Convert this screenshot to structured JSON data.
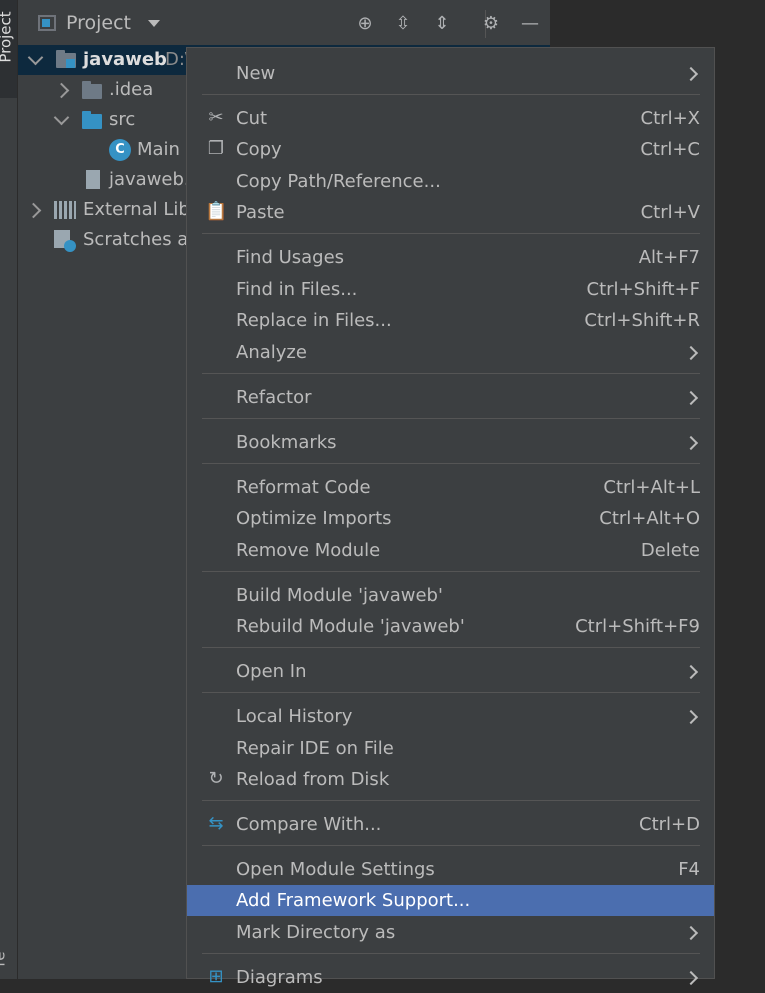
{
  "stripe": {
    "project_label": "Project",
    "bottom_label": "re"
  },
  "header": {
    "title": "Project"
  },
  "tree": {
    "root": {
      "label": "javaweb",
      "path": "D:\\"
    },
    "idea": ".idea",
    "src": "src",
    "main": "Main",
    "iml": "javaweb.i",
    "external": "External Libr",
    "scratches": "Scratches ar"
  },
  "menu": {
    "new": "New",
    "cut": "Cut",
    "cut_sc": "Ctrl+X",
    "copy": "Copy",
    "copy_sc": "Ctrl+C",
    "copy_path": "Copy Path/Reference...",
    "paste": "Paste",
    "paste_sc": "Ctrl+V",
    "find_usages": "Find Usages",
    "find_usages_sc": "Alt+F7",
    "find_in_files": "Find in Files...",
    "find_in_files_sc": "Ctrl+Shift+F",
    "replace_in_files": "Replace in Files...",
    "replace_in_files_sc": "Ctrl+Shift+R",
    "analyze": "Analyze",
    "refactor": "Refactor",
    "bookmarks": "Bookmarks",
    "reformat": "Reformat Code",
    "reformat_sc": "Ctrl+Alt+L",
    "optimize": "Optimize Imports",
    "optimize_sc": "Ctrl+Alt+O",
    "remove_module": "Remove Module",
    "remove_module_sc": "Delete",
    "build_module": "Build Module 'javaweb'",
    "rebuild_module": "Rebuild Module 'javaweb'",
    "rebuild_module_sc": "Ctrl+Shift+F9",
    "open_in": "Open In",
    "local_history": "Local History",
    "repair_ide": "Repair IDE on File",
    "reload": "Reload from Disk",
    "compare": "Compare With...",
    "compare_sc": "Ctrl+D",
    "module_settings": "Open Module Settings",
    "module_settings_sc": "F4",
    "add_framework": "Add Framework Support...",
    "mark_directory": "Mark Directory as",
    "diagrams": "Diagrams"
  },
  "colors": {
    "menu_bg": "#3c3f41",
    "highlight": "#4b6eaf",
    "selection": "#0d293e",
    "folder_blue": "#3592c4"
  }
}
